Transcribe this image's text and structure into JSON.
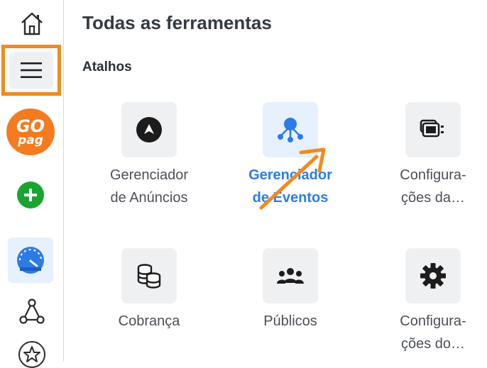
{
  "page": {
    "title": "Todas as ferramentas",
    "section": "Atalhos"
  },
  "sidebar": {
    "items": [
      {
        "icon": "home-icon"
      },
      {
        "icon": "menu-icon",
        "highlighted": true
      },
      {
        "icon": "gopag-logo",
        "logo_text_top": "GO",
        "logo_text_bottom": "pag"
      },
      {
        "icon": "plus-icon"
      },
      {
        "icon": "gauge-icon",
        "active": true
      },
      {
        "icon": "network-icon"
      },
      {
        "icon": "star-icon"
      }
    ]
  },
  "tools": [
    {
      "label": "Gerenciador\nde Anúncios",
      "icon": "ads-manager-icon"
    },
    {
      "label": "Gerenciador\nde Eventos",
      "icon": "events-manager-icon",
      "active": true
    },
    {
      "label": "Configura-\nções da…",
      "icon": "business-settings-icon"
    },
    {
      "label": "Cobrança",
      "icon": "billing-icon"
    },
    {
      "label": "Públicos",
      "icon": "audiences-icon"
    },
    {
      "label": "Configura-\nções do…",
      "icon": "settings-gear-icon"
    }
  ],
  "colors": {
    "accent": "#2d7ce6",
    "highlight": "#f28a1d",
    "brand_gopag": "#f47b20",
    "plus_green": "#1ba331"
  }
}
